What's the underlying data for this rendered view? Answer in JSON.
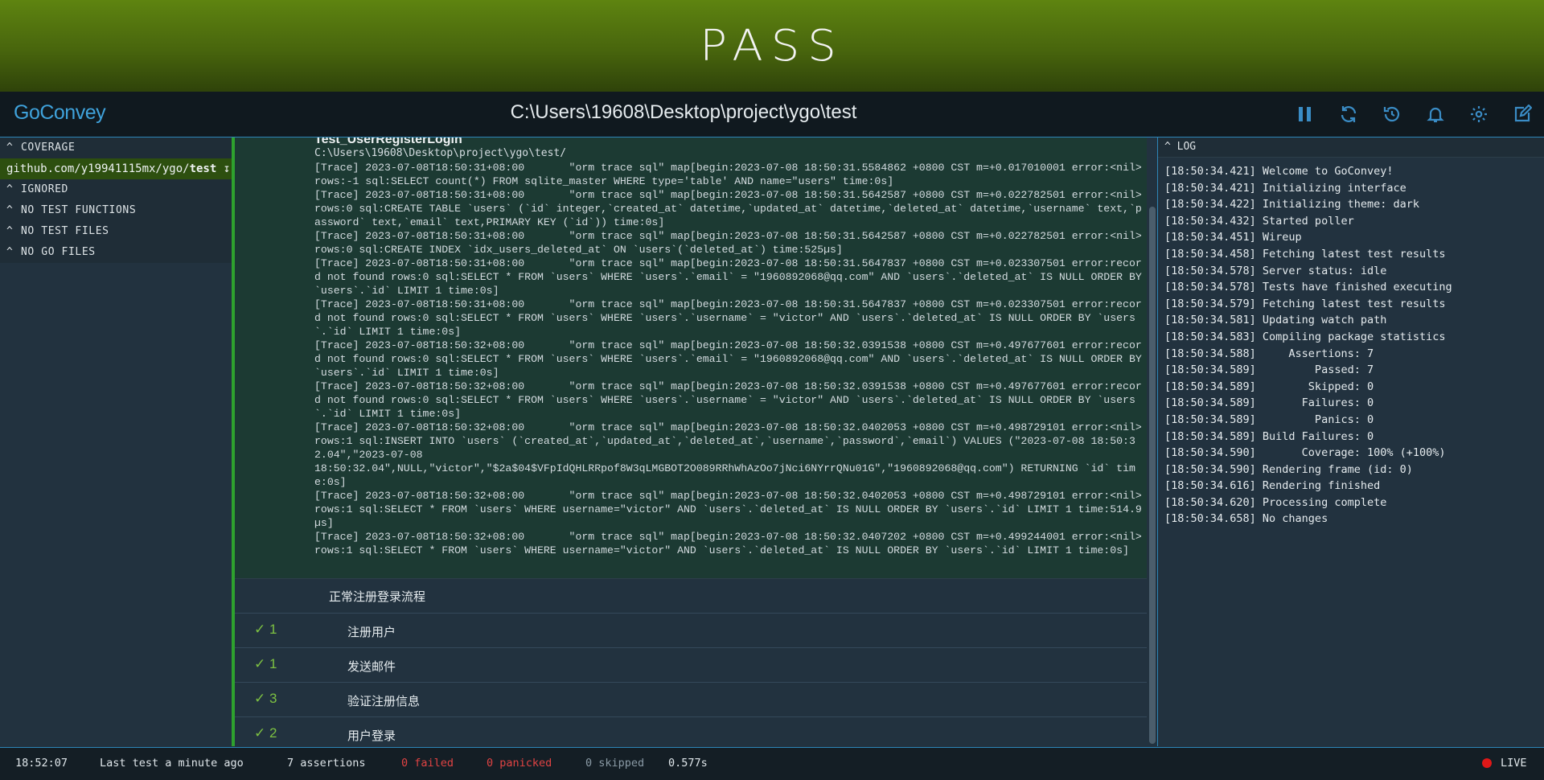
{
  "banner": {
    "status": "PASS"
  },
  "header": {
    "brand": "GoConvey",
    "path": "C:\\Users\\19608\\Desktop\\project\\ygo\\test",
    "icons": [
      "pause-icon",
      "refresh-icon",
      "history-icon",
      "bell-icon",
      "gear-icon",
      "edit-icon"
    ]
  },
  "sidebar": {
    "coverage_label": "COVERAGE",
    "coverage_pkg_prefix": "github.com/y19941115mx/ygo/",
    "coverage_pkg_name": "test",
    "coverage_arrow": "↧",
    "sections": [
      "IGNORED",
      "NO TEST FUNCTIONS",
      "NO TEST FILES",
      "NO GO FILES"
    ]
  },
  "main": {
    "test_name": "Test_UserRegisterLogin",
    "test_path": "C:\\Users\\19608\\Desktop\\project\\ygo\\test/",
    "output": "[Trace] 2023-07-08T18:50:31+08:00       \"orm trace sql\" map[begin:2023-07-08 18:50:31.5584862 +0800 CST m=+0.017010001 error:<nil> rows:-1 sql:SELECT count(*) FROM sqlite_master WHERE type='table' AND name=\"users\" time:0s]\n[Trace] 2023-07-08T18:50:31+08:00       \"orm trace sql\" map[begin:2023-07-08 18:50:31.5642587 +0800 CST m=+0.022782501 error:<nil> rows:0 sql:CREATE TABLE `users` (`id` integer,`created_at` datetime,`updated_at` datetime,`deleted_at` datetime,`username` text,`password` text,`email` text,PRIMARY KEY (`id`)) time:0s]\n[Trace] 2023-07-08T18:50:31+08:00       \"orm trace sql\" map[begin:2023-07-08 18:50:31.5642587 +0800 CST m=+0.022782501 error:<nil> rows:0 sql:CREATE INDEX `idx_users_deleted_at` ON `users`(`deleted_at`) time:525µs]\n[Trace] 2023-07-08T18:50:31+08:00       \"orm trace sql\" map[begin:2023-07-08 18:50:31.5647837 +0800 CST m=+0.023307501 error:record not found rows:0 sql:SELECT * FROM `users` WHERE `users`.`email` = \"1960892068@qq.com\" AND `users`.`deleted_at` IS NULL ORDER BY `users`.`id` LIMIT 1 time:0s]\n[Trace] 2023-07-08T18:50:31+08:00       \"orm trace sql\" map[begin:2023-07-08 18:50:31.5647837 +0800 CST m=+0.023307501 error:record not found rows:0 sql:SELECT * FROM `users` WHERE `users`.`username` = \"victor\" AND `users`.`deleted_at` IS NULL ORDER BY `users`.`id` LIMIT 1 time:0s]\n[Trace] 2023-07-08T18:50:32+08:00       \"orm trace sql\" map[begin:2023-07-08 18:50:32.0391538 +0800 CST m=+0.497677601 error:record not found rows:0 sql:SELECT * FROM `users` WHERE `users`.`email` = \"1960892068@qq.com\" AND `users`.`deleted_at` IS NULL ORDER BY `users`.`id` LIMIT 1 time:0s]\n[Trace] 2023-07-08T18:50:32+08:00       \"orm trace sql\" map[begin:2023-07-08 18:50:32.0391538 +0800 CST m=+0.497677601 error:record not found rows:0 sql:SELECT * FROM `users` WHERE `users`.`username` = \"victor\" AND `users`.`deleted_at` IS NULL ORDER BY `users`.`id` LIMIT 1 time:0s]\n[Trace] 2023-07-08T18:50:32+08:00       \"orm trace sql\" map[begin:2023-07-08 18:50:32.0402053 +0800 CST m=+0.498729101 error:<nil> rows:1 sql:INSERT INTO `users` (`created_at`,`updated_at`,`deleted_at`,`username`,`password`,`email`) VALUES (\"2023-07-08 18:50:32.04\",\"2023-07-08\n18:50:32.04\",NULL,\"victor\",\"$2a$04$VFpIdQHLRRpof8W3qLMGBOT2O089RRhWhAzOo7jNci6NYrrQNu01G\",\"1960892068@qq.com\") RETURNING `id` time:0s]\n[Trace] 2023-07-08T18:50:32+08:00       \"orm trace sql\" map[begin:2023-07-08 18:50:32.0402053 +0800 CST m=+0.498729101 error:<nil> rows:1 sql:SELECT * FROM `users` WHERE username=\"victor\" AND `users`.`deleted_at` IS NULL ORDER BY `users`.`id` LIMIT 1 time:514.9µs]\n[Trace] 2023-07-08T18:50:32+08:00       \"orm trace sql\" map[begin:2023-07-08 18:50:32.0407202 +0800 CST m=+0.499244001 error:<nil> rows:1 sql:SELECT * FROM `users` WHERE username=\"victor\" AND `users`.`deleted_at` IS NULL ORDER BY `users`.`id` LIMIT 1 time:0s]",
    "story_label": "正常注册登录流程",
    "assertions": [
      {
        "count": "✓ 1",
        "label": "注册用户"
      },
      {
        "count": "✓ 1",
        "label": "发送邮件"
      },
      {
        "count": "✓ 3",
        "label": "验证注册信息"
      },
      {
        "count": "✓ 2",
        "label": "用户登录"
      }
    ]
  },
  "log": {
    "title": "LOG",
    "lines": [
      "[18:50:34.421] Welcome to GoConvey!",
      "[18:50:34.421] Initializing interface",
      "[18:50:34.422] Initializing theme: dark",
      "[18:50:34.432] Started poller",
      "[18:50:34.451] Wireup",
      "[18:50:34.458] Fetching latest test results",
      "[18:50:34.578] Server status: idle",
      "[18:50:34.578] Tests have finished executing",
      "[18:50:34.579] Fetching latest test results",
      "[18:50:34.581] Updating watch path",
      "[18:50:34.583] Compiling package statistics",
      "[18:50:34.588]     Assertions: 7",
      "[18:50:34.589]         Passed: 7",
      "[18:50:34.589]        Skipped: 0",
      "[18:50:34.589]       Failures: 0",
      "[18:50:34.589]         Panics: 0",
      "[18:50:34.589] Build Failures: 0",
      "[18:50:34.590]       Coverage: 100% (+100%)",
      "[18:50:34.590] Rendering frame (id: 0)",
      "[18:50:34.616] Rendering finished",
      "[18:50:34.620] Processing complete",
      "[18:50:34.658] No changes"
    ]
  },
  "footer": {
    "time": "18:52:07",
    "last_test": "Last test a minute ago",
    "assertions": "7 assertions",
    "failed": "0 failed",
    "panicked": "0 panicked",
    "skipped": "0 skipped",
    "duration": "0.577s",
    "live": "LIVE"
  },
  "colors": {
    "pass_green": "#5e8410",
    "accent_blue": "#3a8cc5",
    "fail_red": "#e04343",
    "ok_green": "#7dc142"
  }
}
